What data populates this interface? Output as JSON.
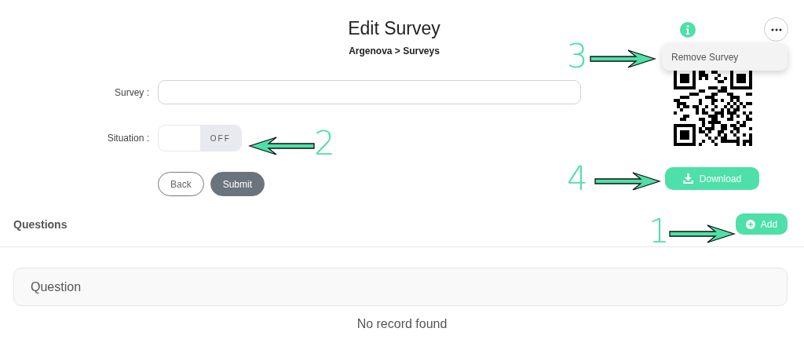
{
  "header": {
    "title": "Edit Survey",
    "breadcrumb": "Argenova > Surveys"
  },
  "form": {
    "survey_label": "Survey :",
    "situation_label": "Situation :",
    "situation": {
      "on": false,
      "label": "OFF"
    },
    "buttons": [
      {
        "label": "Back",
        "kind": "outline"
      },
      {
        "label": "Submit",
        "kind": "solid"
      }
    ]
  },
  "actions": {
    "menu": {
      "expanded": true,
      "items": [
        "Remove Survey"
      ]
    },
    "download": "Download"
  },
  "questions": {
    "title": "Questions",
    "add": "Add",
    "column": "Question",
    "empty": "No record found"
  },
  "annotations": [
    {
      "number": "3",
      "kind": "right"
    },
    {
      "number": "2",
      "kind": "left"
    },
    {
      "number": "4",
      "kind": "right"
    },
    {
      "number": "1",
      "kind": "right"
    }
  ]
}
